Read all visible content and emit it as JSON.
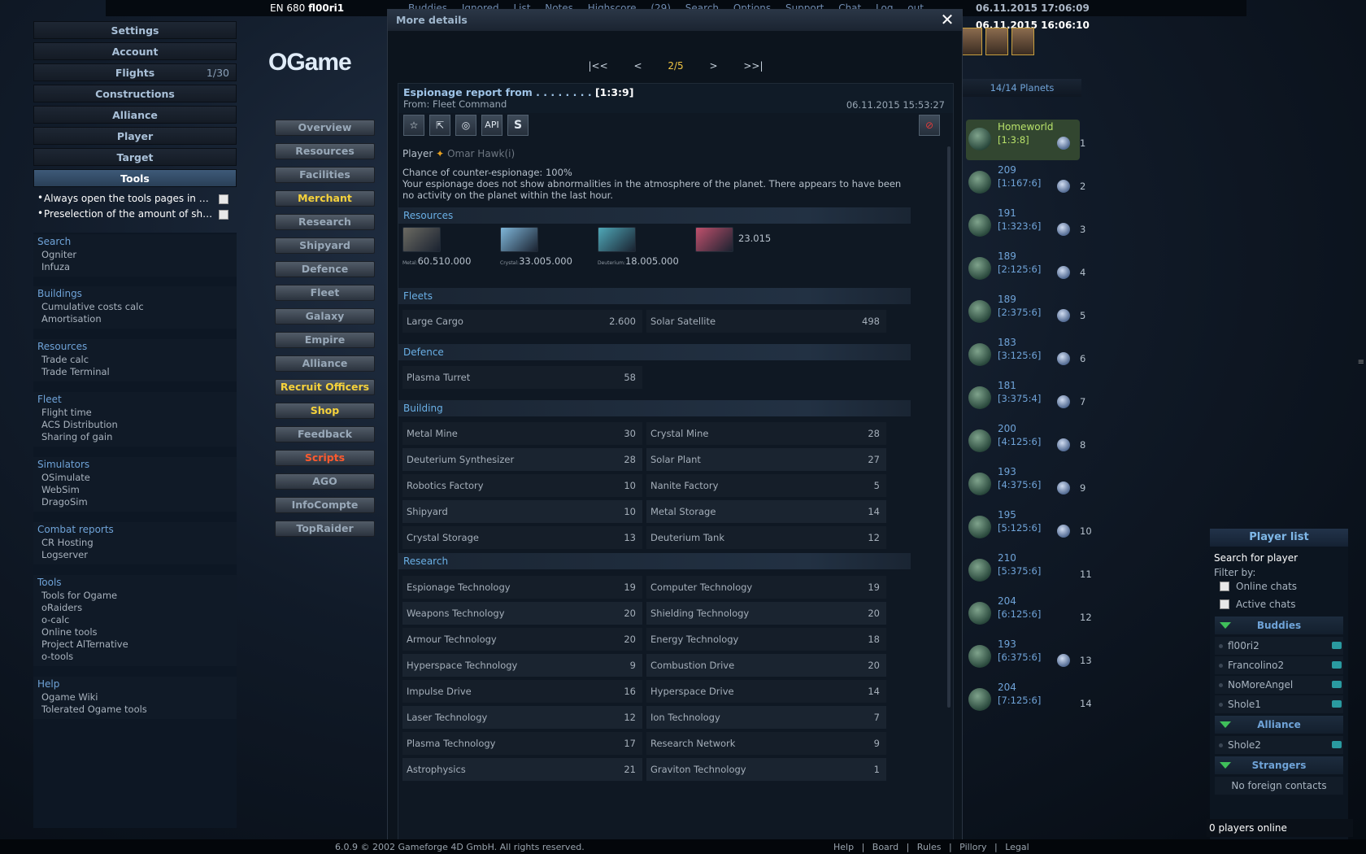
{
  "topbar": {
    "universe": "EN 680",
    "player": "fl00ri1",
    "links": "Buddies Ignored List Notes Highscore (29) Search Options Support Chat Log out",
    "server_time": "06.11.2015 17:06:09",
    "local_time": "06.11.2015 16:06:10"
  },
  "left_menu": {
    "items": [
      "Settings",
      "Account",
      "Flights",
      "Constructions",
      "Alliance",
      "Player",
      "Target",
      "Tools"
    ],
    "flights_count": "1/30",
    "options": [
      "Always open the tools pages in a new tab",
      "Preselection of the amount of ships"
    ]
  },
  "tool_sections": [
    {
      "title": "Search",
      "items": [
        "Ogniter",
        "Infuza"
      ]
    },
    {
      "title": "Buildings",
      "items": [
        "Cumulative costs calc",
        "Amortisation"
      ]
    },
    {
      "title": "Resources",
      "items": [
        "Trade calc",
        "Trade Terminal"
      ]
    },
    {
      "title": "Fleet",
      "items": [
        "Flight time",
        "ACS Distribution",
        "Sharing of gain"
      ]
    },
    {
      "title": "Simulators",
      "items": [
        "OSimulate",
        "WebSim",
        "DragoSim"
      ]
    },
    {
      "title": "Combat reports",
      "items": [
        "CR Hosting",
        "Logserver"
      ]
    },
    {
      "title": "Tools",
      "items": [
        "Tools for Ogame",
        "oRaiders",
        "o-calc",
        "Online tools",
        "Project AlTernative",
        "o-tools"
      ]
    },
    {
      "title": "Help",
      "items": [
        "Ogame Wiki",
        "Tolerated Ogame tools"
      ]
    }
  ],
  "logo": "OGame",
  "center_menu": [
    "Overview",
    "Resources",
    "Facilities",
    "Merchant",
    "Research",
    "Shipyard",
    "Defence",
    "Fleet",
    "Galaxy",
    "Empire",
    "Alliance",
    "Recruit Officers",
    "Shop",
    "Feedback",
    "Scripts",
    "AGO",
    "InfoCompte",
    "TopRaider"
  ],
  "modal": {
    "title": "More details",
    "pager": {
      "first": "|<<",
      "prev": "<",
      "current": "2/5",
      "next": ">",
      "last": ">>|"
    },
    "report_title": "Espionage report from . . . . . . . . ",
    "report_coords": "[1:3:9]",
    "from": "From: Fleet Command",
    "date": "06.11.2015 15:53:27",
    "toolbar": {
      "api": "API",
      "s": "S"
    },
    "player_label": "Player",
    "player_name": "Omar Hawk(i)",
    "counter": "Chance of counter-espionage: 100%",
    "activity": "Your espionage does not show abnormalities in the atmosphere of the planet. There appears to have been no activity on the planet within the last hour.",
    "sections": {
      "resources": "Resources",
      "fleets": "Fleets",
      "defence": "Defence",
      "building": "Building",
      "research": "Research"
    },
    "resources": [
      {
        "label": "Metal:",
        "value": "60.510.000"
      },
      {
        "label": "Crystal:",
        "value": "33.005.000"
      },
      {
        "label": "Deuterium:",
        "value": "18.005.000"
      },
      {
        "label": "",
        "value": "23.015"
      }
    ],
    "fleets": [
      [
        "Large Cargo",
        "2.600"
      ],
      [
        "Solar Satellite",
        "498"
      ]
    ],
    "defence": [
      [
        "Plasma Turret",
        "58"
      ]
    ],
    "building": [
      [
        "Metal Mine",
        "30"
      ],
      [
        "Crystal Mine",
        "28"
      ],
      [
        "Deuterium Synthesizer",
        "28"
      ],
      [
        "Solar Plant",
        "27"
      ],
      [
        "Robotics Factory",
        "10"
      ],
      [
        "Nanite Factory",
        "5"
      ],
      [
        "Shipyard",
        "10"
      ],
      [
        "Metal Storage",
        "14"
      ],
      [
        "Crystal Storage",
        "13"
      ],
      [
        "Deuterium Tank",
        "12"
      ]
    ],
    "research": [
      [
        "Espionage Technology",
        "19"
      ],
      [
        "Computer Technology",
        "19"
      ],
      [
        "Weapons Technology",
        "20"
      ],
      [
        "Shielding Technology",
        "20"
      ],
      [
        "Armour Technology",
        "20"
      ],
      [
        "Energy Technology",
        "18"
      ],
      [
        "Hyperspace Technology",
        "9"
      ],
      [
        "Combustion Drive",
        "20"
      ],
      [
        "Impulse Drive",
        "16"
      ],
      [
        "Hyperspace Drive",
        "14"
      ],
      [
        "Laser Technology",
        "12"
      ],
      [
        "Ion Technology",
        "7"
      ],
      [
        "Plasma Technology",
        "17"
      ],
      [
        "Research Network",
        "9"
      ],
      [
        "Astrophysics",
        "21"
      ],
      [
        "Graviton Technology",
        "1"
      ]
    ]
  },
  "planets_header": "14/14 Planets",
  "planets": [
    {
      "name": "Homeworld",
      "coords": "[1:3:8]",
      "no": "1",
      "moon": true
    },
    {
      "name": "209",
      "coords": "[1:167:6]",
      "no": "2",
      "moon": true
    },
    {
      "name": "191",
      "coords": "[1:323:6]",
      "no": "3",
      "moon": true
    },
    {
      "name": "189",
      "coords": "[2:125:6]",
      "no": "4",
      "moon": true
    },
    {
      "name": "189",
      "coords": "[2:375:6]",
      "no": "5",
      "moon": true
    },
    {
      "name": "183",
      "coords": "[3:125:6]",
      "no": "6",
      "moon": true
    },
    {
      "name": "181",
      "coords": "[3:375:4]",
      "no": "7",
      "moon": true
    },
    {
      "name": "200",
      "coords": "[4:125:6]",
      "no": "8",
      "moon": true
    },
    {
      "name": "193",
      "coords": "[4:375:6]",
      "no": "9",
      "moon": true
    },
    {
      "name": "195",
      "coords": "[5:125:6]",
      "no": "10",
      "moon": true
    },
    {
      "name": "210",
      "coords": "[5:375:6]",
      "no": "11",
      "moon": false
    },
    {
      "name": "204",
      "coords": "[6:125:6]",
      "no": "12",
      "moon": false
    },
    {
      "name": "193",
      "coords": "[6:375:6]",
      "no": "13",
      "moon": true
    },
    {
      "name": "204",
      "coords": "[7:125:6]",
      "no": "14",
      "moon": false
    }
  ],
  "player_list": {
    "title": "Player list",
    "search": "Search for player",
    "filter": "Filter by:",
    "online": "Online chats",
    "active": "Active chats",
    "buddies_label": "Buddies",
    "buddies": [
      "fl00ri2",
      "Francolino2",
      "NoMoreAngel",
      "Shole1"
    ],
    "alliance_label": "Alliance",
    "alliance": [
      "Shole2"
    ],
    "strangers_label": "Strangers",
    "strangers_empty": "No foreign contacts",
    "online_count": "0 players online"
  },
  "footer": {
    "copyright": "6.0.9  © 2002 Gameforge 4D GmbH. All rights reserved.",
    "links": "Help | Board | Rules | Pillory | Legal"
  }
}
